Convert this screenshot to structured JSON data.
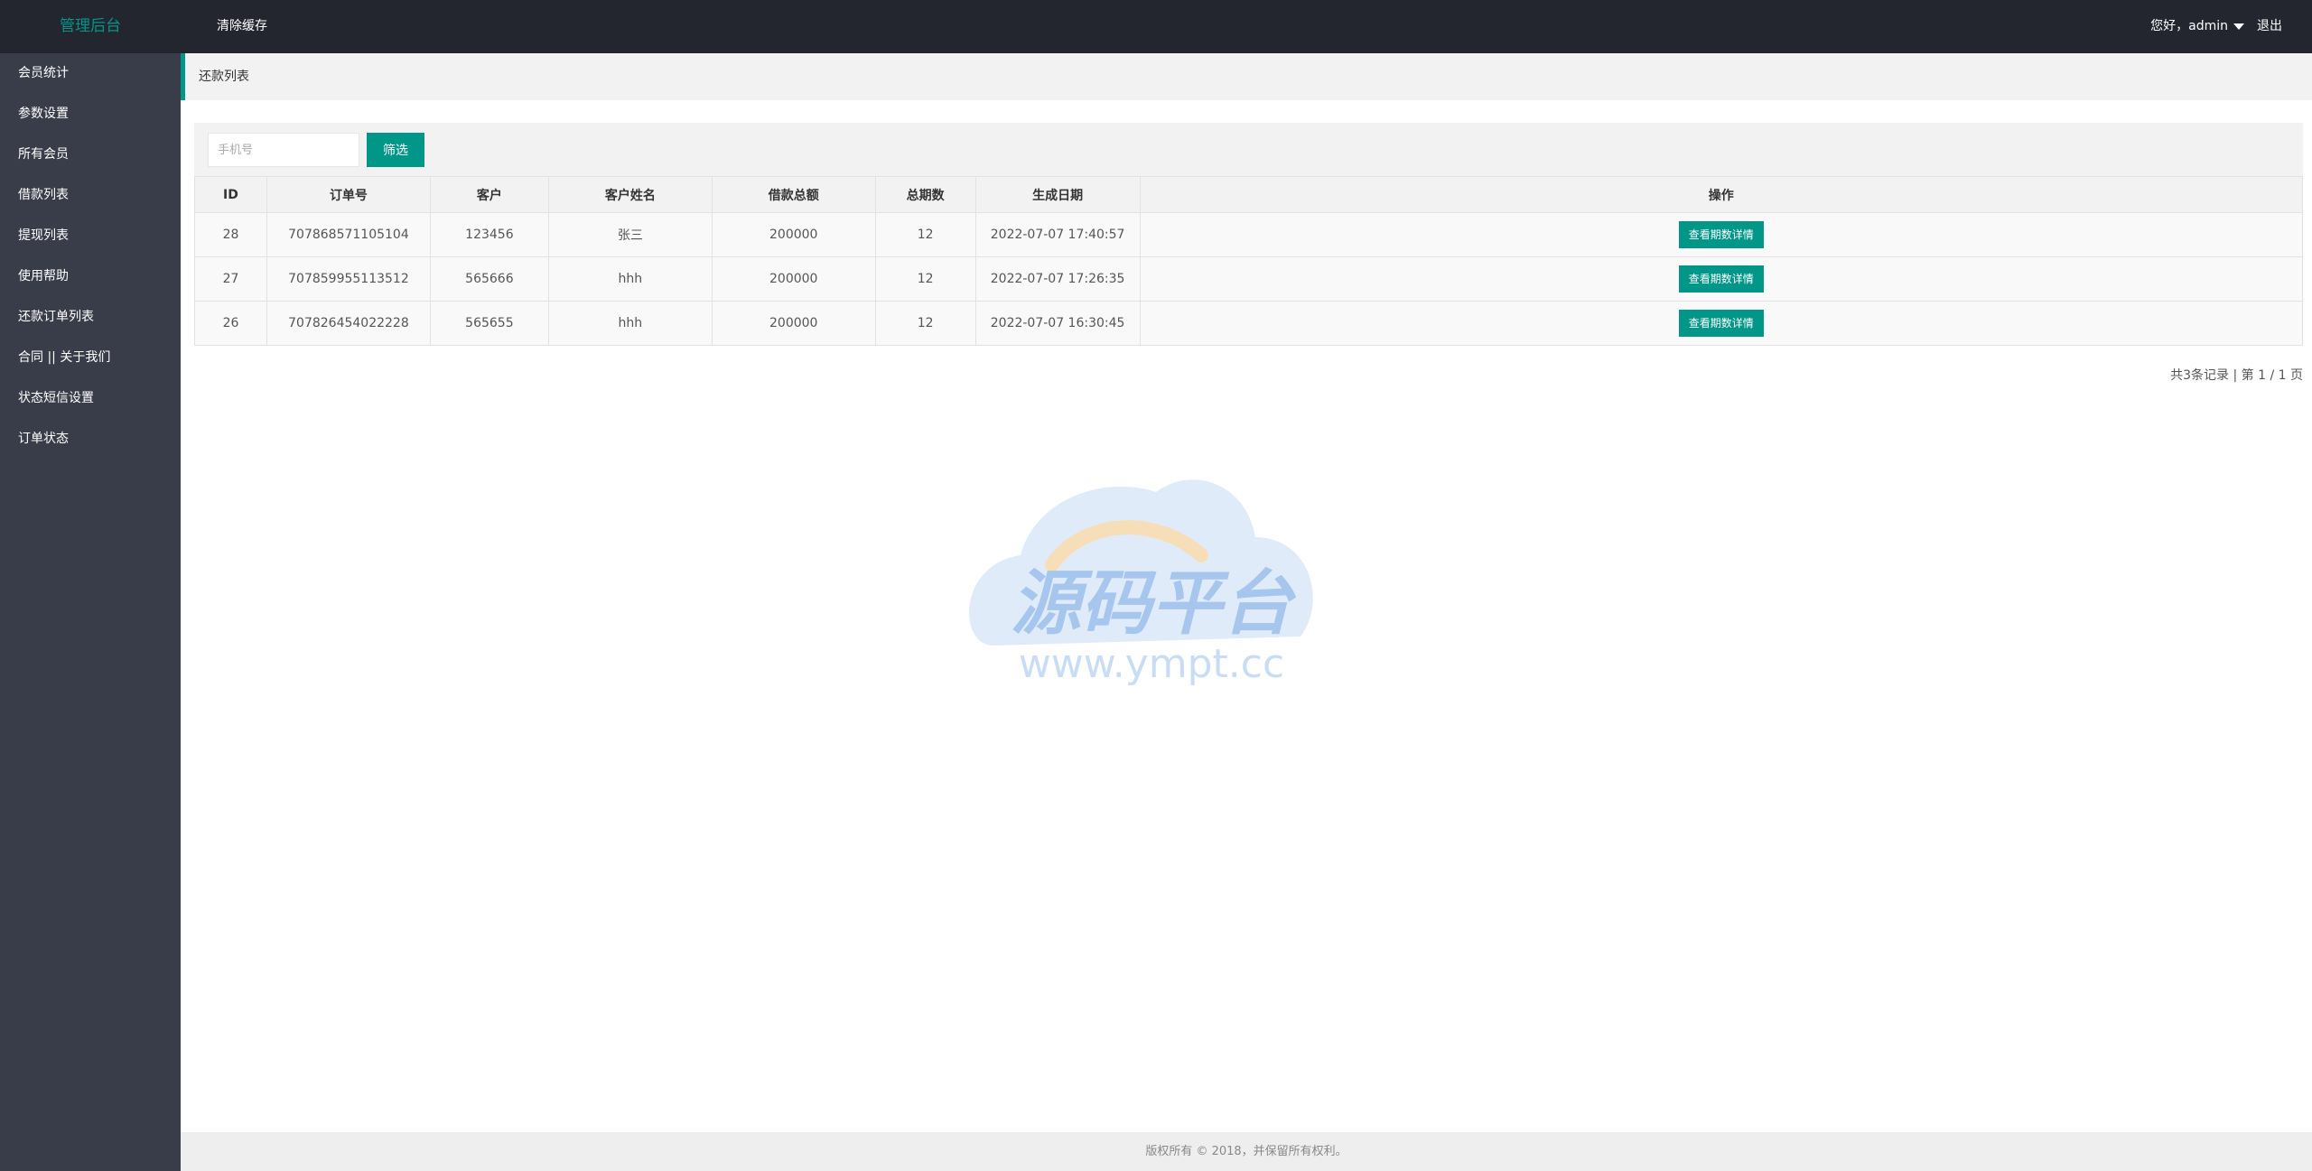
{
  "header": {
    "logo": "管理后台",
    "clear_cache": "清除缓存",
    "greeting": "您好，admin",
    "logout": "退出"
  },
  "sidebar": {
    "items": [
      {
        "label": "会员统计"
      },
      {
        "label": "参数设置"
      },
      {
        "label": "所有会员"
      },
      {
        "label": "借款列表"
      },
      {
        "label": "提现列表"
      },
      {
        "label": "使用帮助"
      },
      {
        "label": "还款订单列表"
      },
      {
        "label": "合同 || 关于我们"
      },
      {
        "label": "状态短信设置"
      },
      {
        "label": "订单状态"
      }
    ]
  },
  "breadcrumb": "还款列表",
  "search": {
    "placeholder": "手机号",
    "value": "",
    "button": "筛选"
  },
  "table": {
    "headers": [
      "ID",
      "订单号",
      "客户",
      "客户姓名",
      "借款总额",
      "总期数",
      "生成日期",
      "操作"
    ],
    "action_label": "查看期数详情",
    "rows": [
      {
        "id": "28",
        "order_no": "707868571105104",
        "customer": "123456",
        "name": "张三",
        "amount": "200000",
        "periods": "12",
        "date": "2022-07-07 17:40:57"
      },
      {
        "id": "27",
        "order_no": "707859955113512",
        "customer": "565666",
        "name": "hhh",
        "amount": "200000",
        "periods": "12",
        "date": "2022-07-07 17:26:35"
      },
      {
        "id": "26",
        "order_no": "707826454022228",
        "customer": "565655",
        "name": "hhh",
        "amount": "200000",
        "periods": "12",
        "date": "2022-07-07 16:30:45"
      }
    ]
  },
  "pager": "共3条记录 | 第 1 / 1 页",
  "watermark": {
    "title": "源码平台",
    "url": "www.ympt.cc"
  },
  "footer": "版权所有 © 2018，并保留所有权利。",
  "colors": {
    "accent": "#009688",
    "header_bg": "#23262e",
    "sidebar_bg": "#393d49",
    "amount": "#c00000"
  }
}
